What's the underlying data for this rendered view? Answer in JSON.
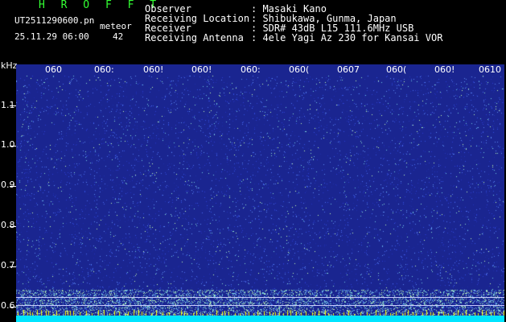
{
  "header": {
    "app_title": "H R O F F T",
    "file_name": "UT2511290600.pn",
    "mode": "meteor",
    "date_time": "25.11.29 06:00",
    "count": "42"
  },
  "station_info": [
    {
      "key": "Observer",
      "value": ": Masaki Kano"
    },
    {
      "key": "Receiving Location",
      "value": ": Shibukawa, Gunma, Japan"
    },
    {
      "key": "Receiver",
      "value": ": SDR# 43dB L15 111.6MHz USB"
    },
    {
      "key": "Receiving Antenna",
      "value": ": 4ele Yagi Az 230 for Kansai VOR"
    }
  ],
  "y_axis": {
    "unit": "kHz",
    "ticks": [
      "1.1",
      "1.0",
      "0.9",
      "0.8",
      "0.7",
      "0.6"
    ]
  },
  "time_axis": {
    "labels": [
      "060",
      "060:",
      "060!",
      "060!",
      "060:",
      "060(",
      "0607",
      "060(",
      "060!",
      "0610"
    ]
  },
  "colors": {
    "background": "#000000",
    "spectrogram_base": "#1a2590",
    "title_green": "#33ff33",
    "bottom_strip": "#00e5ff",
    "marker_yellow": "#ffff00"
  }
}
